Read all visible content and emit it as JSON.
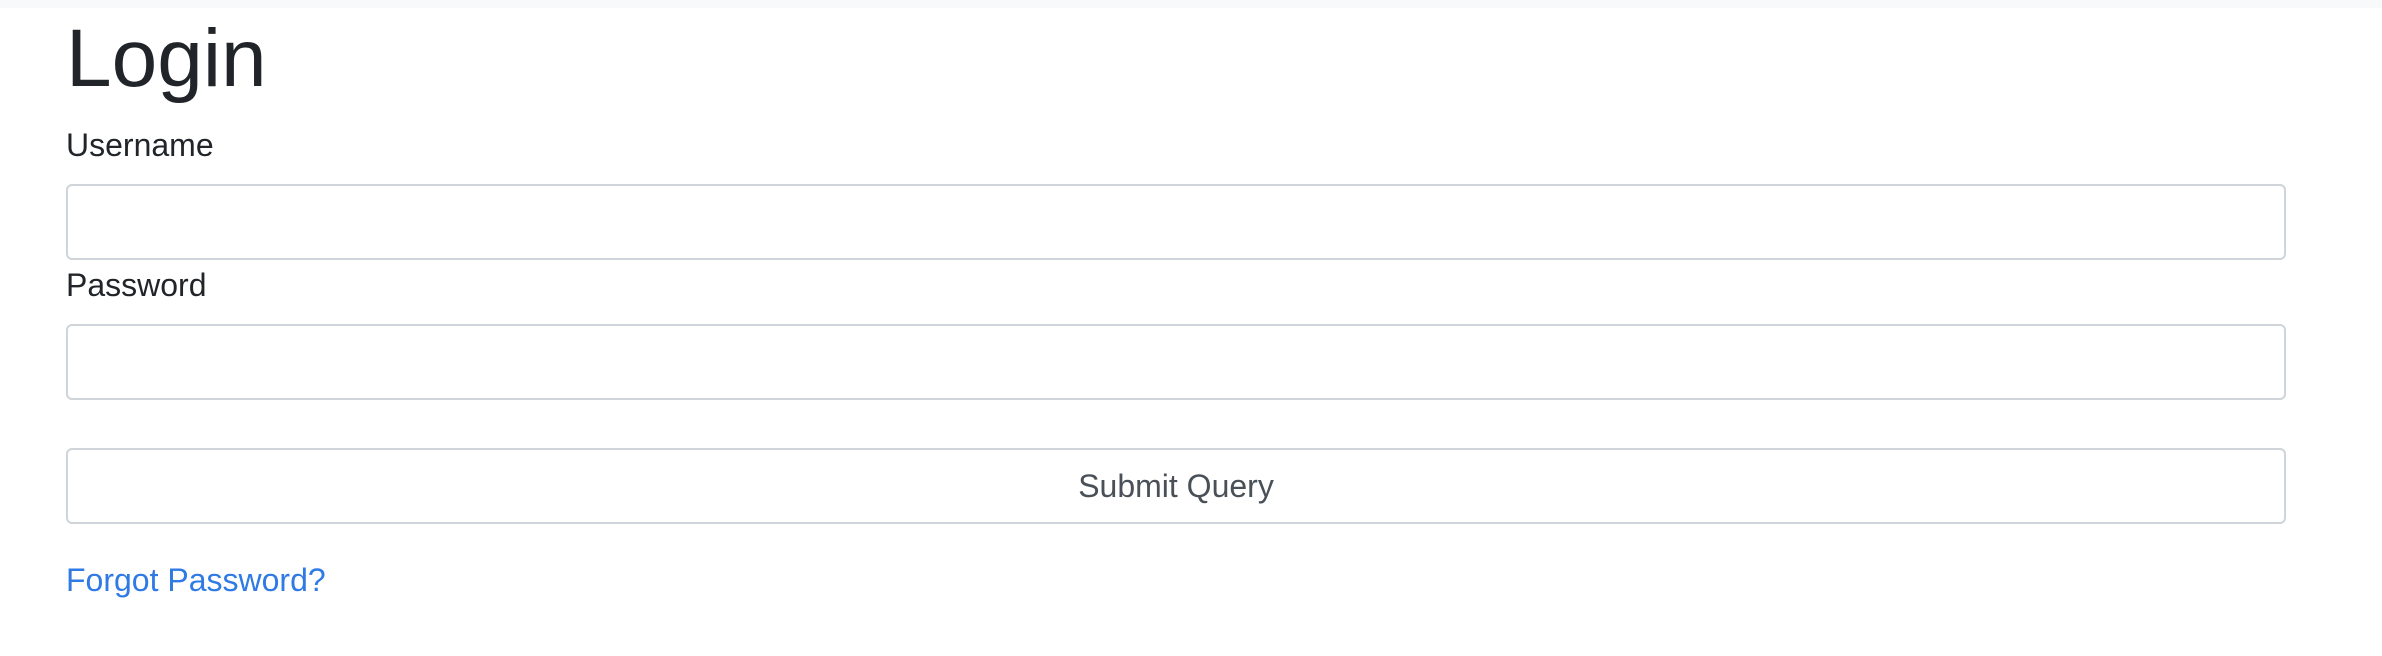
{
  "page": {
    "title": "Login"
  },
  "form": {
    "username_label": "Username",
    "username_value": "",
    "password_label": "Password",
    "password_value": "",
    "submit_label": "Submit Query",
    "forgot_password_label": "Forgot Password?"
  },
  "colors": {
    "link": "#2f7ae5",
    "text": "#212529",
    "input_border": "#ced4da",
    "top_strip": "#f8f9fa"
  }
}
